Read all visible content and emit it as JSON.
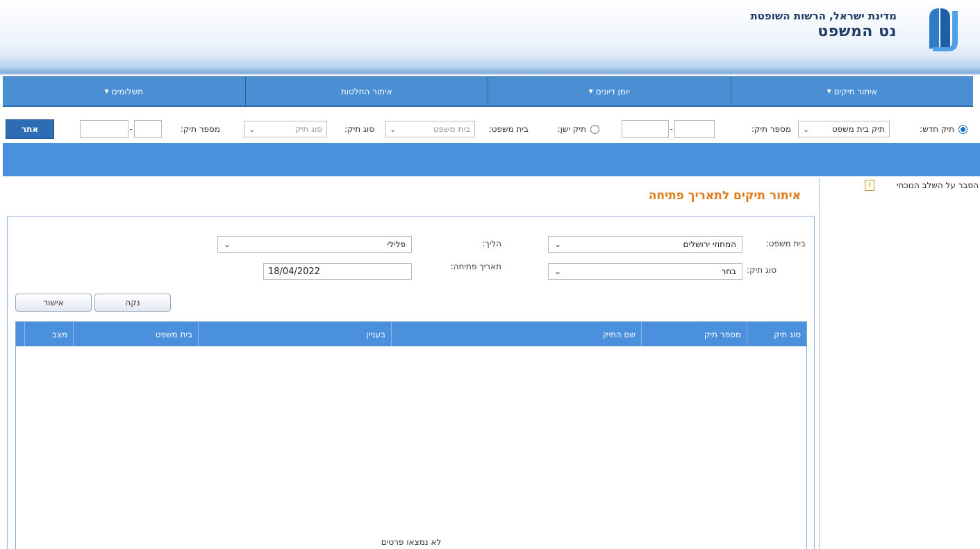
{
  "header": {
    "subtitle": "מדינת ישראל, הרשות השופטת",
    "title": "נט המשפט"
  },
  "nav": {
    "items": [
      {
        "label": "איתור תיקים",
        "caret": "▼"
      },
      {
        "label": "יומן דיונים",
        "caret": "▼"
      },
      {
        "label": "איתור החלטות",
        "caret": ""
      },
      {
        "label": "תשלומים",
        "caret": "▼"
      }
    ]
  },
  "search": {
    "new_case_label": "תיק חדש:",
    "court_case_select": "תיק בית משפט",
    "case_number_label": "מספר תיק:",
    "old_case_label": "תיק ישן:",
    "court_label": "בית משפט:",
    "court_select": "בית משפט",
    "case_type_label": "סוג תיק:",
    "case_type_select": "סוג תיק",
    "case_number_label2": "מספר תיק:",
    "dash": "-",
    "search_button": "אתר",
    "chevron": "⌄"
  },
  "side": {
    "help_label": "הסבר על השלב הנוכחי",
    "info_icon": "i"
  },
  "page": {
    "title": "איתור תיקים לתאריך פתיחה"
  },
  "form": {
    "court_label": "בית משפט:",
    "court_value": "המחוזי ירושלים",
    "procedure_label": "הליך:",
    "procedure_value": "פלילי",
    "case_type_label": "סוג תיק:",
    "case_type_value": "בחר",
    "open_date_label": "תאריך פתיחה:",
    "open_date_value": "18/04/2022",
    "clear_button": "נקה",
    "confirm_button": "אישור",
    "chevron": "⌄"
  },
  "grid": {
    "columns": [
      "סוג תיק",
      "מספר תיק",
      "שם התיק",
      "בעניין",
      "בית משפט",
      "מצב"
    ],
    "empty_message": "לא נמצאו פרטים"
  }
}
